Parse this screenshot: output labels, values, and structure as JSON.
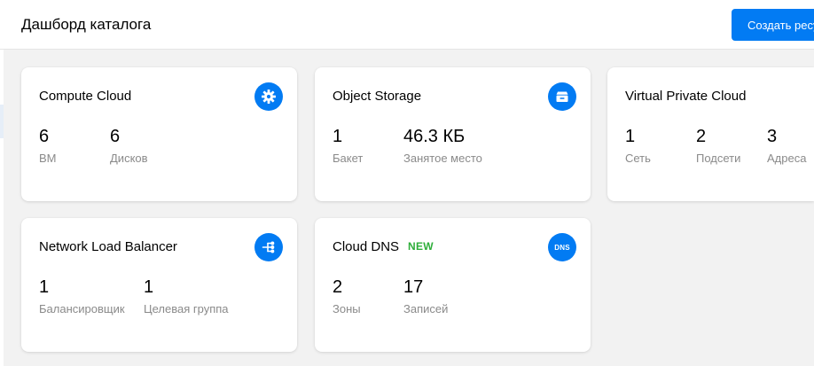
{
  "header": {
    "title": "Дашборд каталога",
    "create_button_label": "Создать ресурс"
  },
  "colors": {
    "accent": "#027bf3",
    "badge_new": "#2eae3a",
    "stat_label": "#8a8a8a"
  },
  "cards": [
    {
      "title": "Compute Cloud",
      "icon": "gear-icon",
      "stats": [
        {
          "value": "6",
          "label": "ВМ"
        },
        {
          "value": "6",
          "label": "Дисков"
        }
      ]
    },
    {
      "title": "Object Storage",
      "icon": "storage-icon",
      "stats": [
        {
          "value": "1",
          "label": "Бакет"
        },
        {
          "value": "46.3 КБ",
          "label": "Занятое место"
        }
      ]
    },
    {
      "title": "Virtual Private Cloud",
      "icon": "network-icon",
      "stats": [
        {
          "value": "1",
          "label": "Сеть"
        },
        {
          "value": "2",
          "label": "Подсети"
        },
        {
          "value": "3",
          "label": "Адреса"
        }
      ]
    },
    {
      "title": "Network Load Balancer",
      "icon": "load-balancer-icon",
      "stats": [
        {
          "value": "1",
          "label": "Балансировщик"
        },
        {
          "value": "1",
          "label": "Целевая группа"
        }
      ]
    },
    {
      "title": "Cloud DNS",
      "badge": "NEW",
      "icon": "dns-icon",
      "icon_text": "DNS",
      "stats": [
        {
          "value": "2",
          "label": "Зоны"
        },
        {
          "value": "17",
          "label": "Записей"
        }
      ]
    }
  ]
}
